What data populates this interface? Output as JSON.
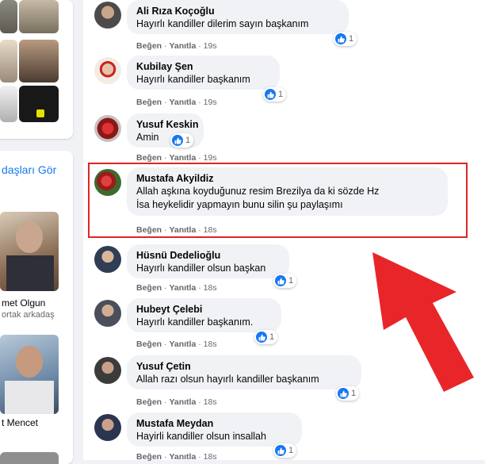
{
  "sidebar": {
    "friends_link": "daşları Gör",
    "friends": [
      {
        "name": "met Olgun",
        "sub": "ortak arkadaş"
      },
      {
        "name": "t Mencet",
        "sub": ""
      }
    ]
  },
  "comments": [
    {
      "author": "Ali Rıza Koçoğlu",
      "text": "Hayırlı kandiller dilerim sayın başkanım",
      "like": "Beğen",
      "reply": "Yanıtla",
      "time": "19s",
      "reactions": "1"
    },
    {
      "author": "Kubilay Şen",
      "text": "Hayırlı kandiller başkanım",
      "like": "Beğen",
      "reply": "Yanıtla",
      "time": "19s",
      "reactions": "1"
    },
    {
      "author": "Yusuf Keskin",
      "text": "Amin",
      "like": "Beğen",
      "reply": "Yanıtla",
      "time": "19s",
      "reactions": "1"
    },
    {
      "author": "Mustafa Akyildiz",
      "text_line1": "Allah aşkına koyduğunuz resim Brezilya da ki sözde Hz",
      "text_line2": "İsa heykelidir yapmayın bunu silin şu paylaşımı",
      "like": "Beğen",
      "reply": "Yanıtla",
      "time": "18s"
    },
    {
      "author": "Hüsnü Dedelioğlu",
      "text": "Hayırlı kandiller olsun başkan",
      "like": "Beğen",
      "reply": "Yanıtla",
      "time": "18s",
      "reactions": "1"
    },
    {
      "author": "Hubeyt Çelebi",
      "text": "Hayırlı kandiller başkanım.",
      "like": "Beğen",
      "reply": "Yanıtla",
      "time": "18s",
      "reactions": "1"
    },
    {
      "author": "Yusuf Çetin",
      "text": "Allah razı olsun hayırlı kandiller başkanım",
      "like": "Beğen",
      "reply": "Yanıtla",
      "time": "18s",
      "reactions": "1"
    },
    {
      "author": "Mustafa Meydan",
      "text": "Hayirli kandiller olsun insallah",
      "like": "Beğen",
      "reply": "Yanıtla",
      "time": "18s",
      "reactions": "1"
    }
  ],
  "colors": {
    "highlight": "#e02424",
    "like_blue": "#1877f2",
    "arrow": "#e8262a"
  }
}
